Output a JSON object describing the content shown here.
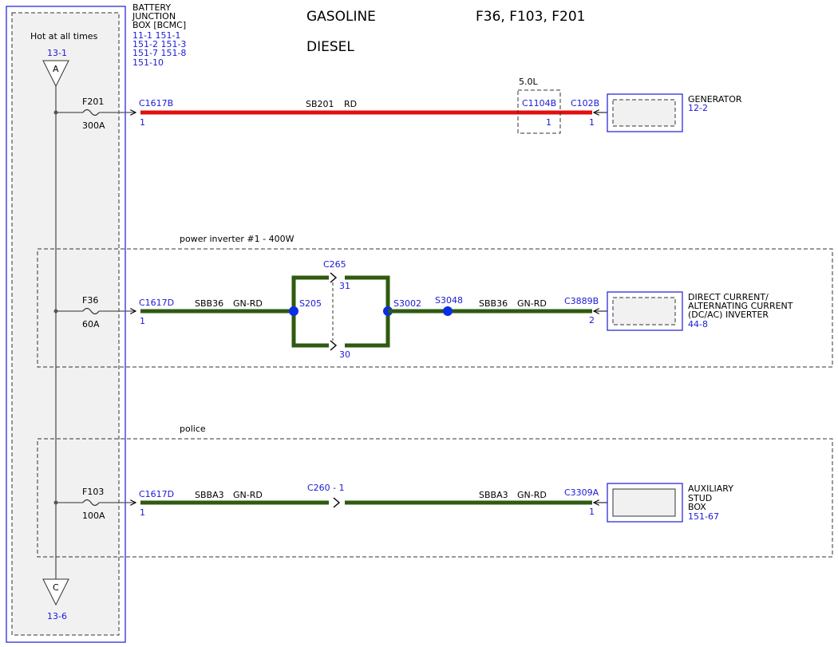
{
  "colors": {
    "red_wire": "#e01010",
    "green_wire": "#2f5a10",
    "green_fill": "#3c6e14",
    "blue": "#1a1ad6",
    "splice": "#0a2ee6"
  },
  "header": {
    "gasoline": "GASOLINE",
    "diesel": "DIESEL",
    "fuses": "F36, F103, F201"
  },
  "bjb": {
    "title": [
      "BATTERY",
      "JUNCTION",
      "BOX [BCMC]"
    ],
    "refs": [
      "11-1  151-1",
      "151-2 151-3",
      "151-7 151-8",
      "151-10"
    ],
    "hot_label": "Hot at all times",
    "top_ref": "13-1",
    "top_letter": "A",
    "bottom_ref": "13-6",
    "bottom_letter": "C"
  },
  "circuit_1": {
    "fuse": "F201",
    "amps": "300A",
    "conn_left": "C1617B",
    "pin_left": "1",
    "wire": "SB201",
    "color": "RD",
    "option": "5.0L",
    "inline_conn": "C1104B",
    "inline_pin": "1",
    "conn_right": "C102B",
    "pin_right": "1",
    "component": [
      "GENERATOR"
    ],
    "component_ref": "12-2"
  },
  "circuit_2": {
    "group": "power inverter #1 - 400W",
    "fuse": "F36",
    "amps": "60A",
    "conn_left": "C1617D",
    "pin_left": "1",
    "wire_left": "SBB36",
    "color_left": "GN-RD",
    "splice_1": "S205",
    "mid_conn": "C265",
    "mid_pin_top": "31",
    "mid_pin_bottom": "30",
    "splice_2": "S3002",
    "splice_3": "S3048",
    "wire_right": "SBB36",
    "color_right": "GN-RD",
    "conn_right": "C3889B",
    "pin_right": "2",
    "component": [
      "DIRECT CURRENT/",
      "ALTERNATING CURRENT",
      "(DC/AC) INVERTER"
    ],
    "component_ref": "44-8"
  },
  "circuit_3": {
    "group": "police",
    "fuse": "F103",
    "amps": "100A",
    "conn_left": "C1617D",
    "pin_left": "1",
    "wire_left": "SBBA3",
    "color_left": "GN-RD",
    "mid_conn": "C260 -  1",
    "wire_right": "SBBA3",
    "color_right": "GN-RD",
    "conn_right": "C3309A",
    "pin_right": "1",
    "component": [
      "AUXILIARY",
      "STUD",
      "BOX"
    ],
    "component_ref": "151-67"
  }
}
